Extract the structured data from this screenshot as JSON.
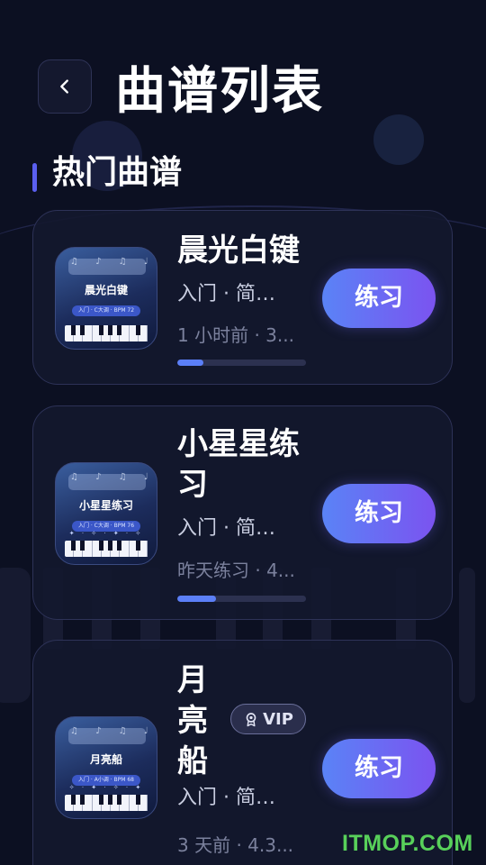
{
  "header": {
    "title": "曲谱列表",
    "back_icon": "chevron-left-icon"
  },
  "section": {
    "title": "热门曲谱"
  },
  "songs": [
    {
      "title": "晨光白键",
      "meta": "入门 · 简…",
      "last_practiced": "1 小时前 · 3...",
      "progress_percent": 20,
      "action_label": "练习",
      "vip": false,
      "cover": {
        "title": "晨光白键",
        "chip": "入门 · C大调 · BPM 72",
        "notes": "♫ ♪ ♫ ♩"
      }
    },
    {
      "title": "小星星练习",
      "meta": "入门 · 简…",
      "last_practiced": "昨天练习 · 4...",
      "progress_percent": 30,
      "action_label": "练习",
      "vip": false,
      "cover": {
        "title": "小星星练习",
        "chip": "入门 · C大调 · BPM 76",
        "notes": "♫ ♪ ♫ ♩"
      }
    },
    {
      "title": "月亮船",
      "meta": "入门 · 简…",
      "last_practiced": "3 天前 · 4.3...",
      "progress_percent": null,
      "action_label": "练习",
      "vip": true,
      "vip_label": "VIP",
      "cover": {
        "title": "月亮船",
        "chip": "入门 · A小调 · BPM 68",
        "notes": "♫ ♪ ♫ ♩"
      }
    }
  ],
  "watermark": "ITMOP.COM",
  "colors": {
    "background": "#0c1022",
    "card": "#14182e",
    "accent_start": "#5a83f6",
    "accent_end": "#7b53f0",
    "progress": "#5b7ff7",
    "watermark": "#58d05a"
  }
}
